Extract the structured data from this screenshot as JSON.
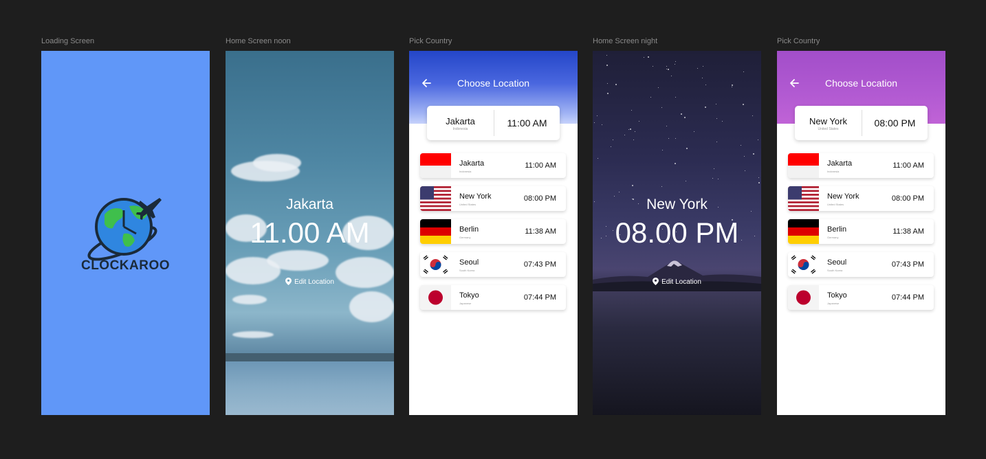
{
  "frame_labels": {
    "loading": "Loading Screen",
    "noon": "Home Screen noon",
    "pick1": "Pick Country",
    "night": "Home Screen night",
    "pick2": "Pick Country"
  },
  "loading": {
    "brand": "CLOCKAROO",
    "background": "#6097f8"
  },
  "noon": {
    "city": "Jakarta",
    "time": "11.00 AM",
    "edit_location": "Edit Location"
  },
  "night": {
    "city": "New York",
    "time": "08.00 PM",
    "edit_location": "Edit Location"
  },
  "pick1": {
    "title": "Choose Location",
    "header_color": "#2446c8",
    "current": {
      "city": "Jakarta",
      "country": "Indonesia",
      "time": "11:00 AM"
    }
  },
  "pick2": {
    "title": "Choose Location",
    "header_color": "#a24ec9",
    "current": {
      "city": "New York",
      "country": "United States",
      "time": "08:00 PM"
    }
  },
  "countries": [
    {
      "city": "Jakarta",
      "country": "Indonesia",
      "time": "11:00 AM",
      "flag": "indonesia"
    },
    {
      "city": "New York",
      "country": "United States",
      "time": "08:00 PM",
      "flag": "usa"
    },
    {
      "city": "Berlin",
      "country": "Germany",
      "time": "11:38 AM",
      "flag": "germany"
    },
    {
      "city": "Seoul",
      "country": "South Korea",
      "time": "07:43 PM",
      "flag": "south-korea"
    },
    {
      "city": "Tokyo",
      "country": "Japanese",
      "time": "07:44 PM",
      "flag": "japan"
    }
  ]
}
